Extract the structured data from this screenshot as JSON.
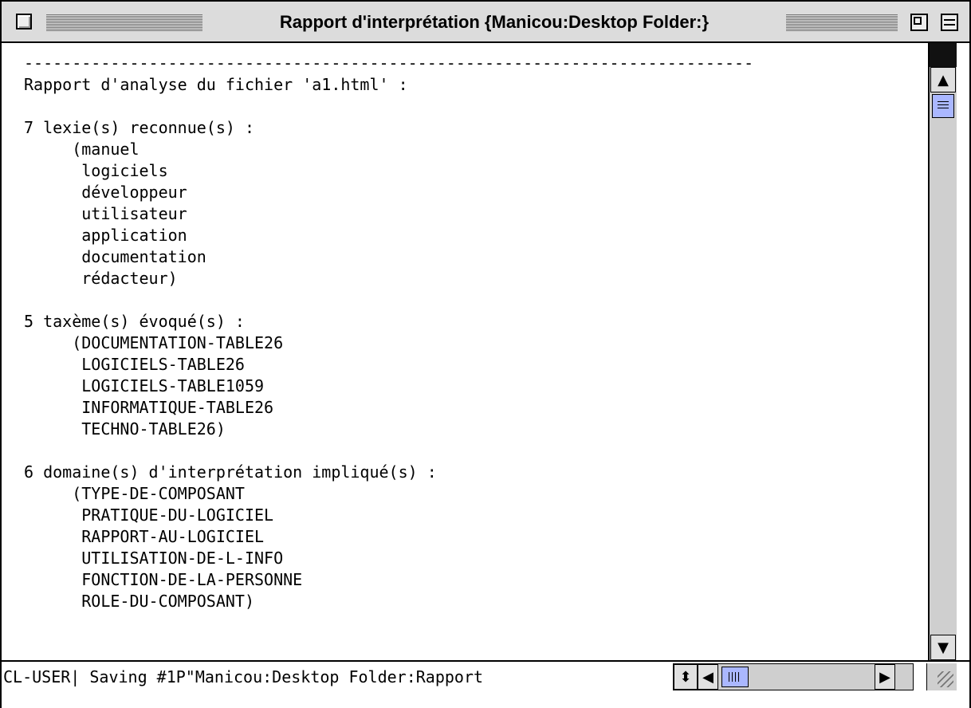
{
  "window": {
    "title": "Rapport d'interprétation {Manicou:Desktop Folder:}"
  },
  "report": {
    "lines": [
      "----------------------------------------------------------------------------",
      "Rapport d'analyse du fichier 'a1.html' :",
      "",
      "7 lexie(s) reconnue(s) :",
      "     (manuel",
      "      logiciels",
      "      développeur",
      "      utilisateur",
      "      application",
      "      documentation",
      "      rédacteur)",
      "",
      "5 taxème(s) évoqué(s) :",
      "     (DOCUMENTATION-TABLE26",
      "      LOGICIELS-TABLE26",
      "      LOGICIELS-TABLE1059",
      "      INFORMATIQUE-TABLE26",
      "      TECHNO-TABLE26)",
      "",
      "6 domaine(s) d'interprétation impliqué(s) :",
      "     (TYPE-DE-COMPOSANT",
      "      PRATIQUE-DU-LOGICIEL",
      "      RAPPORT-AU-LOGICIEL",
      "      UTILISATION-DE-L-INFO",
      "      FONCTION-DE-LA-PERSONNE",
      "      ROLE-DU-COMPOSANT)",
      "",
      "",
      "----------------------------------------------------------------------------"
    ]
  },
  "status": {
    "text": "CL-USER| Saving #1P\"Manicou:Desktop Folder:Rapport"
  },
  "icons": {
    "close": "close-box-icon",
    "zoom": "zoom-box-icon",
    "collapse": "collapse-box-icon",
    "up": "▲",
    "down": "▼",
    "left": "◀",
    "right": "▶",
    "updown": "⬍"
  },
  "colors": {
    "titlebar": "#dcdcdc",
    "scroll_track": "#cfcfcf",
    "thumb": "#aab7ff"
  }
}
